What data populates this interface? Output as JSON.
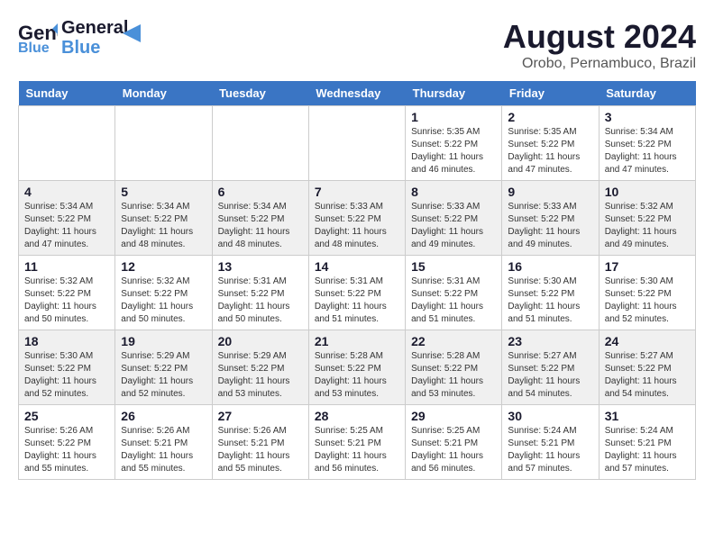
{
  "logo": {
    "general": "General",
    "blue": "Blue",
    "arrow_color": "#4a90d9"
  },
  "header": {
    "title": "August 2024",
    "subtitle": "Orobo, Pernambuco, Brazil"
  },
  "weekdays": [
    "Sunday",
    "Monday",
    "Tuesday",
    "Wednesday",
    "Thursday",
    "Friday",
    "Saturday"
  ],
  "weeks": [
    {
      "days": [
        {
          "num": "",
          "info": ""
        },
        {
          "num": "",
          "info": ""
        },
        {
          "num": "",
          "info": ""
        },
        {
          "num": "",
          "info": ""
        },
        {
          "num": "1",
          "info": "Sunrise: 5:35 AM\nSunset: 5:22 PM\nDaylight: 11 hours\nand 46 minutes."
        },
        {
          "num": "2",
          "info": "Sunrise: 5:35 AM\nSunset: 5:22 PM\nDaylight: 11 hours\nand 47 minutes."
        },
        {
          "num": "3",
          "info": "Sunrise: 5:34 AM\nSunset: 5:22 PM\nDaylight: 11 hours\nand 47 minutes."
        }
      ]
    },
    {
      "days": [
        {
          "num": "4",
          "info": "Sunrise: 5:34 AM\nSunset: 5:22 PM\nDaylight: 11 hours\nand 47 minutes."
        },
        {
          "num": "5",
          "info": "Sunrise: 5:34 AM\nSunset: 5:22 PM\nDaylight: 11 hours\nand 48 minutes."
        },
        {
          "num": "6",
          "info": "Sunrise: 5:34 AM\nSunset: 5:22 PM\nDaylight: 11 hours\nand 48 minutes."
        },
        {
          "num": "7",
          "info": "Sunrise: 5:33 AM\nSunset: 5:22 PM\nDaylight: 11 hours\nand 48 minutes."
        },
        {
          "num": "8",
          "info": "Sunrise: 5:33 AM\nSunset: 5:22 PM\nDaylight: 11 hours\nand 49 minutes."
        },
        {
          "num": "9",
          "info": "Sunrise: 5:33 AM\nSunset: 5:22 PM\nDaylight: 11 hours\nand 49 minutes."
        },
        {
          "num": "10",
          "info": "Sunrise: 5:32 AM\nSunset: 5:22 PM\nDaylight: 11 hours\nand 49 minutes."
        }
      ]
    },
    {
      "days": [
        {
          "num": "11",
          "info": "Sunrise: 5:32 AM\nSunset: 5:22 PM\nDaylight: 11 hours\nand 50 minutes."
        },
        {
          "num": "12",
          "info": "Sunrise: 5:32 AM\nSunset: 5:22 PM\nDaylight: 11 hours\nand 50 minutes."
        },
        {
          "num": "13",
          "info": "Sunrise: 5:31 AM\nSunset: 5:22 PM\nDaylight: 11 hours\nand 50 minutes."
        },
        {
          "num": "14",
          "info": "Sunrise: 5:31 AM\nSunset: 5:22 PM\nDaylight: 11 hours\nand 51 minutes."
        },
        {
          "num": "15",
          "info": "Sunrise: 5:31 AM\nSunset: 5:22 PM\nDaylight: 11 hours\nand 51 minutes."
        },
        {
          "num": "16",
          "info": "Sunrise: 5:30 AM\nSunset: 5:22 PM\nDaylight: 11 hours\nand 51 minutes."
        },
        {
          "num": "17",
          "info": "Sunrise: 5:30 AM\nSunset: 5:22 PM\nDaylight: 11 hours\nand 52 minutes."
        }
      ]
    },
    {
      "days": [
        {
          "num": "18",
          "info": "Sunrise: 5:30 AM\nSunset: 5:22 PM\nDaylight: 11 hours\nand 52 minutes."
        },
        {
          "num": "19",
          "info": "Sunrise: 5:29 AM\nSunset: 5:22 PM\nDaylight: 11 hours\nand 52 minutes."
        },
        {
          "num": "20",
          "info": "Sunrise: 5:29 AM\nSunset: 5:22 PM\nDaylight: 11 hours\nand 53 minutes."
        },
        {
          "num": "21",
          "info": "Sunrise: 5:28 AM\nSunset: 5:22 PM\nDaylight: 11 hours\nand 53 minutes."
        },
        {
          "num": "22",
          "info": "Sunrise: 5:28 AM\nSunset: 5:22 PM\nDaylight: 11 hours\nand 53 minutes."
        },
        {
          "num": "23",
          "info": "Sunrise: 5:27 AM\nSunset: 5:22 PM\nDaylight: 11 hours\nand 54 minutes."
        },
        {
          "num": "24",
          "info": "Sunrise: 5:27 AM\nSunset: 5:22 PM\nDaylight: 11 hours\nand 54 minutes."
        }
      ]
    },
    {
      "days": [
        {
          "num": "25",
          "info": "Sunrise: 5:26 AM\nSunset: 5:22 PM\nDaylight: 11 hours\nand 55 minutes."
        },
        {
          "num": "26",
          "info": "Sunrise: 5:26 AM\nSunset: 5:21 PM\nDaylight: 11 hours\nand 55 minutes."
        },
        {
          "num": "27",
          "info": "Sunrise: 5:26 AM\nSunset: 5:21 PM\nDaylight: 11 hours\nand 55 minutes."
        },
        {
          "num": "28",
          "info": "Sunrise: 5:25 AM\nSunset: 5:21 PM\nDaylight: 11 hours\nand 56 minutes."
        },
        {
          "num": "29",
          "info": "Sunrise: 5:25 AM\nSunset: 5:21 PM\nDaylight: 11 hours\nand 56 minutes."
        },
        {
          "num": "30",
          "info": "Sunrise: 5:24 AM\nSunset: 5:21 PM\nDaylight: 11 hours\nand 57 minutes."
        },
        {
          "num": "31",
          "info": "Sunrise: 5:24 AM\nSunset: 5:21 PM\nDaylight: 11 hours\nand 57 minutes."
        }
      ]
    }
  ],
  "row_colors": [
    "#ffffff",
    "#f0f0f0",
    "#ffffff",
    "#f0f0f0",
    "#ffffff"
  ]
}
